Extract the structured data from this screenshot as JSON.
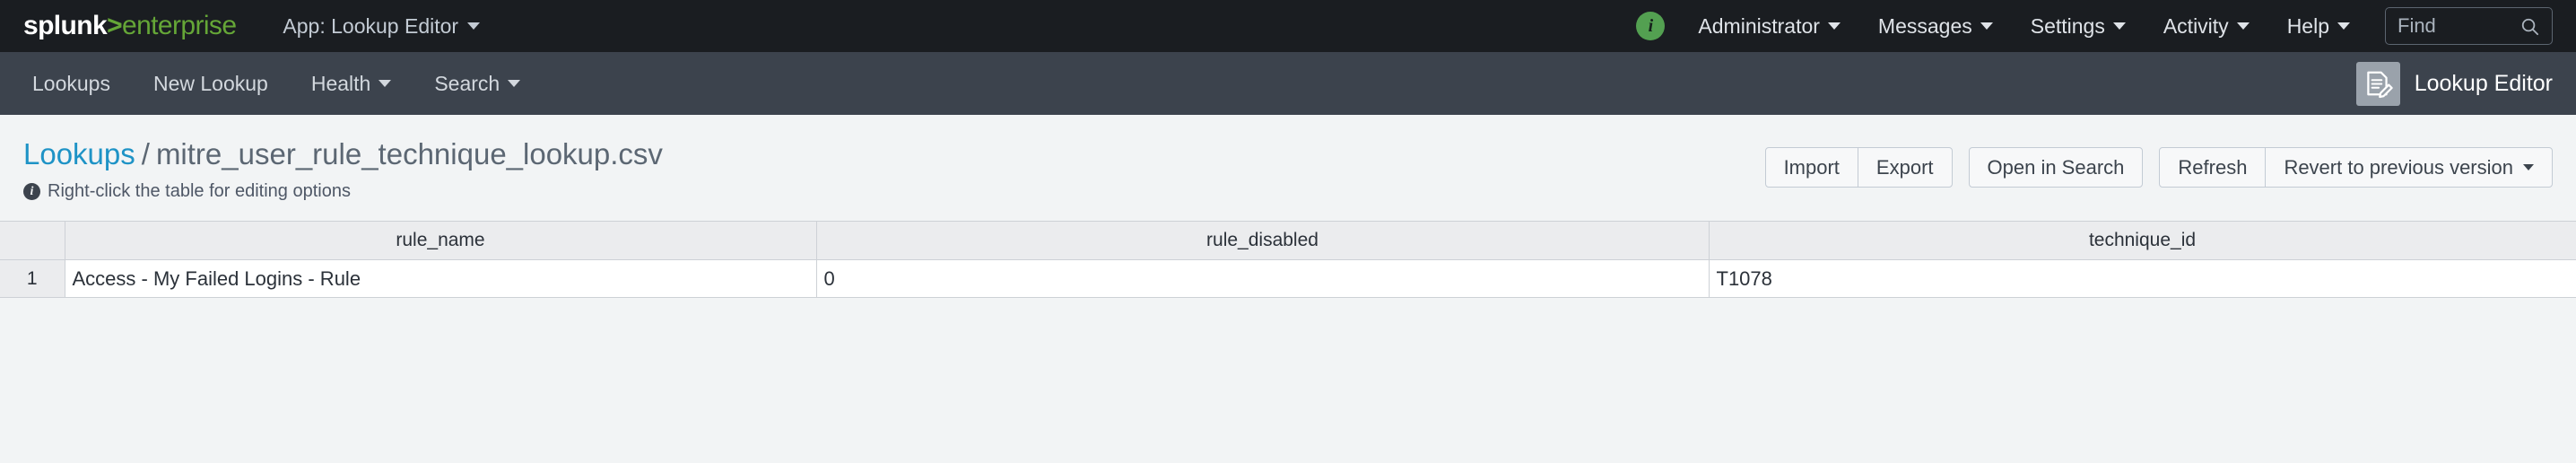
{
  "topbar": {
    "logo": {
      "brand": "splunk",
      "separator": ">",
      "edition": "enterprise"
    },
    "app_menu": {
      "label": "App: Lookup Editor",
      "icon": "chevron-down-icon"
    },
    "info_badge": {
      "glyph": "i",
      "color": "#53a051"
    },
    "items": [
      {
        "label": "Administrator",
        "caret": true
      },
      {
        "label": "Messages",
        "caret": true
      },
      {
        "label": "Settings",
        "caret": true
      },
      {
        "label": "Activity",
        "caret": true
      },
      {
        "label": "Help",
        "caret": true
      }
    ],
    "find": {
      "placeholder": "Find",
      "value": "",
      "icon": "search-icon"
    }
  },
  "appnav": {
    "items": [
      {
        "label": "Lookups",
        "caret": false
      },
      {
        "label": "New Lookup",
        "caret": false
      },
      {
        "label": "Health",
        "caret": true
      },
      {
        "label": "Search",
        "caret": true
      }
    ],
    "brand": {
      "label": "Lookup Editor",
      "icon": "document-pencil-icon"
    }
  },
  "page": {
    "breadcrumb": {
      "parent": "Lookups",
      "separator": "/",
      "current": "mitre_user_rule_technique_lookup.csv"
    },
    "hint": {
      "icon": "info-icon",
      "text": "Right-click the table for editing options"
    },
    "actions": [
      {
        "group": [
          "Import",
          "Export"
        ]
      },
      {
        "group": [
          "Open in Search"
        ]
      },
      {
        "group": [
          "Refresh",
          "Revert to previous version"
        ]
      }
    ],
    "action_labels": {
      "import": "Import",
      "export": "Export",
      "open_in_search": "Open in Search",
      "refresh": "Refresh",
      "revert": "Revert to previous version"
    }
  },
  "table": {
    "columns": [
      "rule_name",
      "rule_disabled",
      "technique_id"
    ],
    "rows": [
      {
        "number": "1",
        "cells": [
          "Access - My Failed Logins - Rule",
          "0",
          "T1078"
        ]
      }
    ]
  },
  "colors": {
    "topbar_bg": "#1a1d21",
    "appnav_bg": "#3c434d",
    "page_bg": "#f2f4f5",
    "accent_green": "#65a637",
    "link_blue": "#1e93c6",
    "header_row_bg": "#ebecee",
    "border": "#cdd1d6"
  }
}
